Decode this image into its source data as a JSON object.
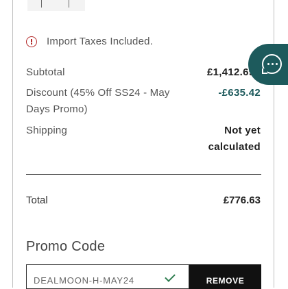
{
  "notice": {
    "icon": "info-circle-icon",
    "text": "Import Taxes Included."
  },
  "summary": {
    "subtotal_label": "Subtotal",
    "subtotal_value": "£1,412.69",
    "discount_label": "Discount (45% Off SS24 - May Days Promo)",
    "discount_value": "-£635.42",
    "shipping_label": "Shipping",
    "shipping_value": "Not yet calculated",
    "total_label": "Total",
    "total_value": "£776.63"
  },
  "promo": {
    "heading": "Promo Code",
    "code": "DEALMOON-H-MAY24",
    "remove_label": "REMOVE"
  },
  "colors": {
    "accent": "#1d5a5c",
    "notice_icon": "#b42a2a",
    "button_bg": "#111111"
  }
}
